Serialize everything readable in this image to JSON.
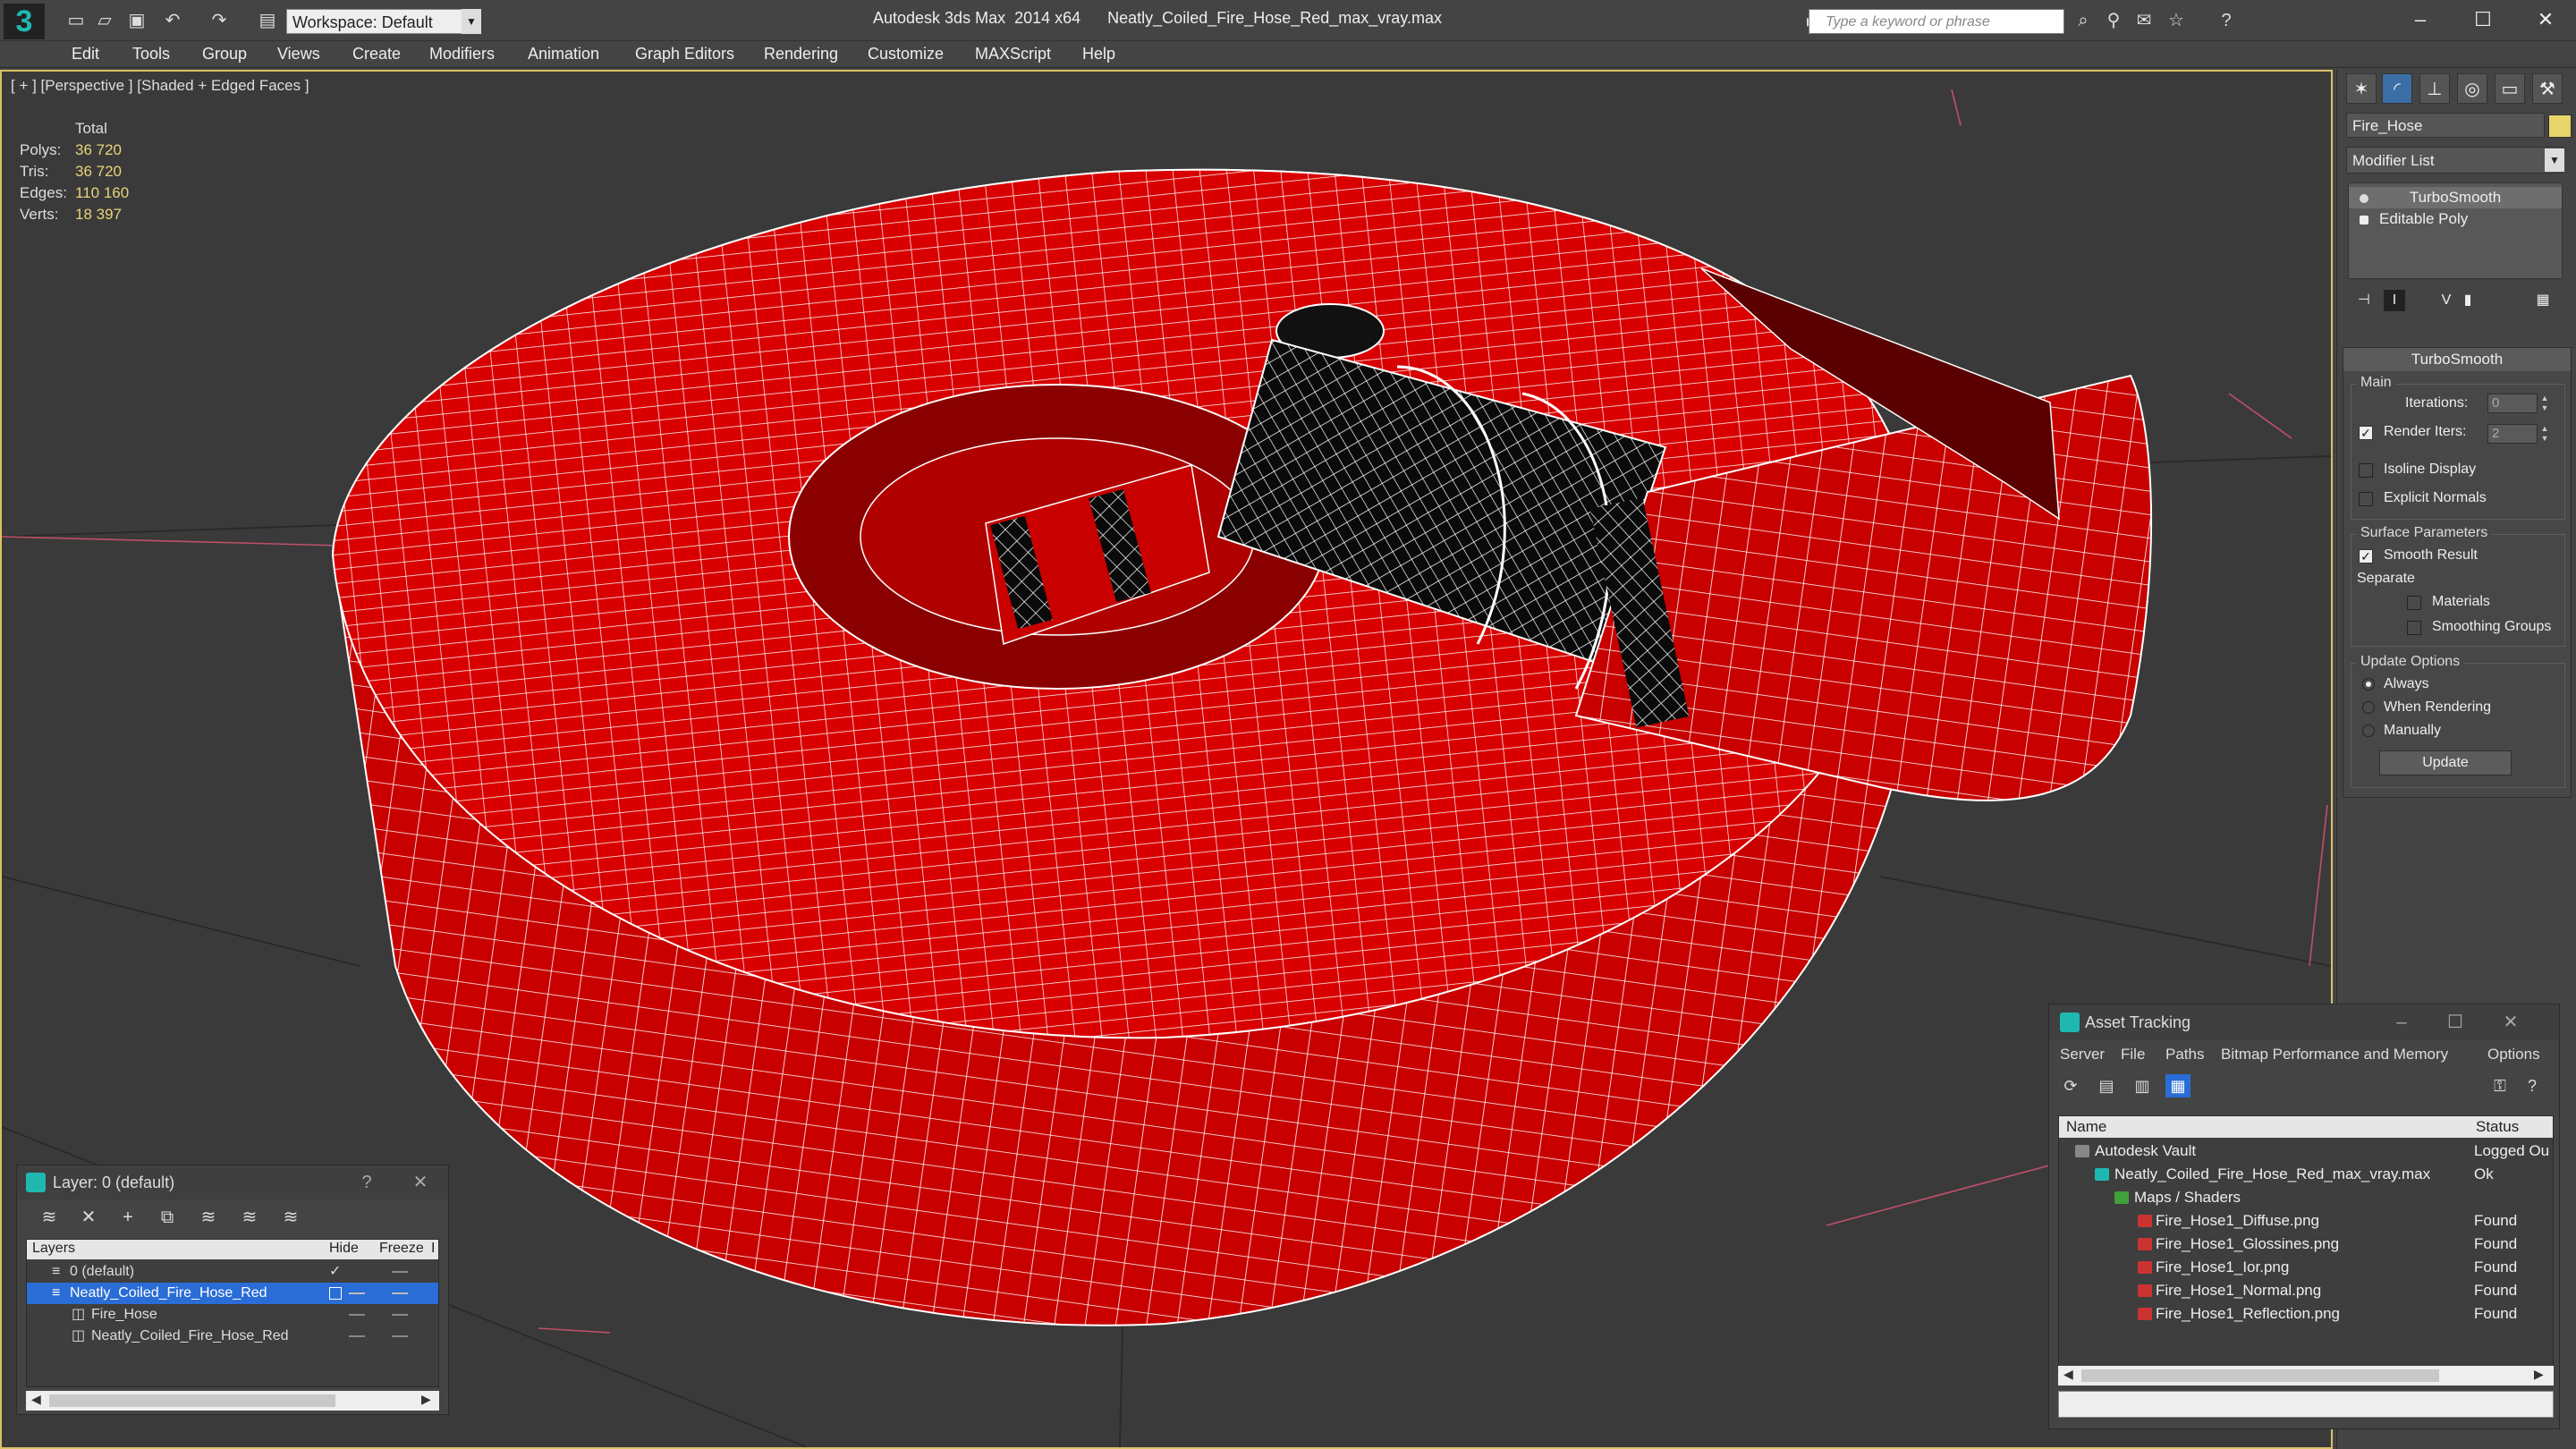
{
  "titlebar": {
    "workspace": "Workspace: Default",
    "window_title": "Autodesk 3ds Max  2014 x64      Neatly_Coiled_Fire_Hose_Red_max_vray.max",
    "search_placeholder": "Type a keyword or phrase"
  },
  "menu": [
    "Edit",
    "Tools",
    "Group",
    "Views",
    "Create",
    "Modifiers",
    "Animation",
    "Graph Editors",
    "Rendering",
    "Customize",
    "MAXScript",
    "Help"
  ],
  "viewport": {
    "label": "[ + ] [Perspective ] [Shaded + Edged Faces ]",
    "stats": {
      "header": "Total",
      "rows": [
        {
          "label": "Polys:",
          "value": "36 720"
        },
        {
          "label": "Tris:",
          "value": "36 720"
        },
        {
          "label": "Edges:",
          "value": "110 160"
        },
        {
          "label": "Verts:",
          "value": "18 397"
        }
      ]
    },
    "hose_color": "#d40000",
    "wire_color": "#ffffff",
    "selection_border": "#d9c266"
  },
  "command_panel": {
    "object_name": "Fire_Hose",
    "object_color": "#e8d56a",
    "modifier_list": "Modifier List",
    "stack": [
      "TurboSmooth",
      "Editable Poly"
    ],
    "rollout_title": "TurboSmooth",
    "main": {
      "title": "Main",
      "iterations_label": "Iterations:",
      "iterations_value": "0",
      "render_iters_label": "Render Iters:",
      "render_iters_value": "2",
      "isoline_label": "Isoline Display",
      "explicit_normals_label": "Explicit Normals"
    },
    "surface": {
      "title": "Surface Parameters",
      "smooth_result_label": "Smooth Result",
      "separate_label": "Separate",
      "materials_label": "Materials",
      "smoothing_groups_label": "Smoothing Groups"
    },
    "update": {
      "title": "Update Options",
      "always_label": "Always",
      "when_rendering_label": "When Rendering",
      "manually_label": "Manually",
      "button_label": "Update"
    }
  },
  "layer_window": {
    "title": "Layer: 0 (default)",
    "headers": {
      "layers": "Layers",
      "hide": "Hide",
      "freeze": "Freeze",
      "extra": "I"
    },
    "rows": [
      {
        "name": "0 (default)"
      },
      {
        "name": "Neatly_Coiled_Fire_Hose_Red"
      },
      {
        "name": "Fire_Hose"
      },
      {
        "name": "Neatly_Coiled_Fire_Hose_Red"
      }
    ]
  },
  "asset_window": {
    "title": "Asset Tracking",
    "menu": [
      "Server",
      "File",
      "Paths",
      "Bitmap Performance and Memory",
      "Options"
    ],
    "headers": {
      "name": "Name",
      "status": "Status"
    },
    "rows": [
      {
        "name": "Autodesk Vault",
        "status": "Logged Ou"
      },
      {
        "name": "Neatly_Coiled_Fire_Hose_Red_max_vray.max",
        "status": "Ok"
      },
      {
        "name": "Maps / Shaders",
        "status": ""
      },
      {
        "name": "Fire_Hose1_Diffuse.png",
        "status": "Found"
      },
      {
        "name": "Fire_Hose1_Glossines.png",
        "status": "Found"
      },
      {
        "name": "Fire_Hose1_Ior.png",
        "status": "Found"
      },
      {
        "name": "Fire_Hose1_Normal.png",
        "status": "Found"
      },
      {
        "name": "Fire_Hose1_Reflection.png",
        "status": "Found"
      }
    ]
  }
}
